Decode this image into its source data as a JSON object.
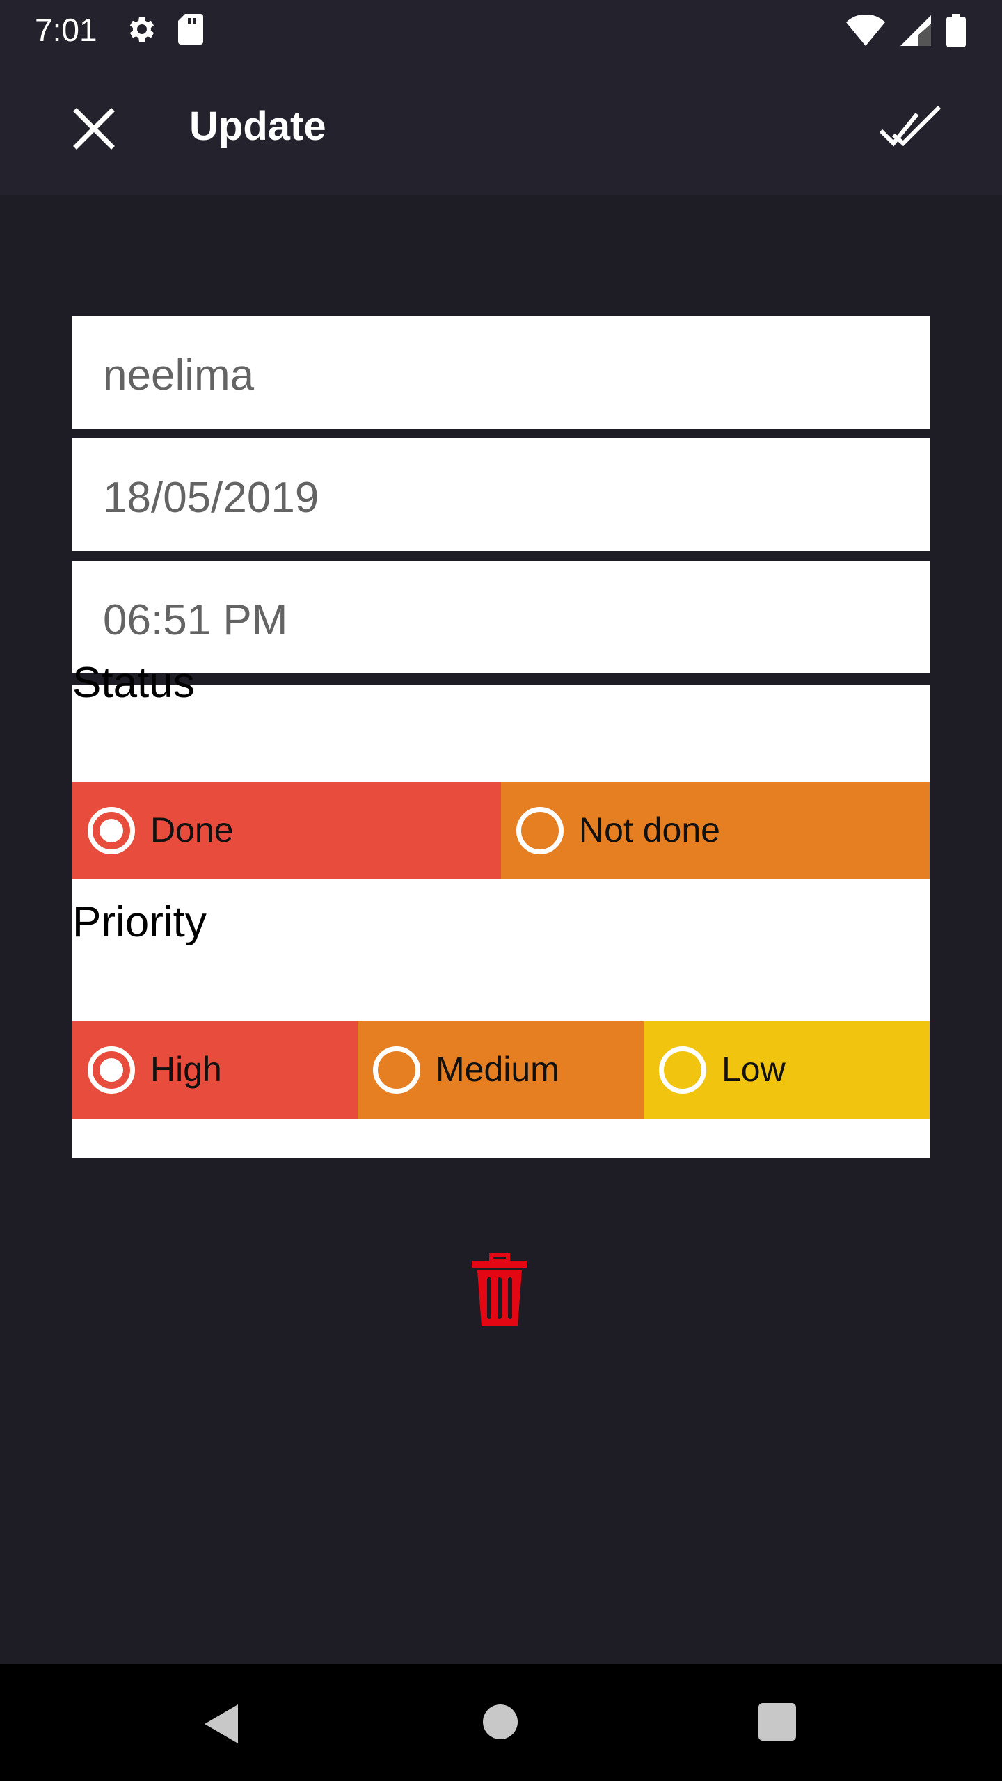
{
  "status_bar": {
    "time": "7:01",
    "icons": [
      "settings-icon",
      "sd-card-icon",
      "wifi-icon",
      "signal-icon",
      "battery-icon"
    ]
  },
  "toolbar": {
    "title": "Update",
    "close_icon": "close-icon",
    "confirm_icon": "double-check-icon"
  },
  "form": {
    "name": "neelima",
    "date": "18/05/2019",
    "time": "06:51 PM"
  },
  "status": {
    "label": "Status",
    "options": [
      {
        "label": "Done",
        "checked": true,
        "color": "#e74c3c"
      },
      {
        "label": "Not done",
        "checked": false,
        "color": "#e67e22"
      }
    ]
  },
  "priority": {
    "label": "Priority",
    "options": [
      {
        "label": "High",
        "checked": true,
        "color": "#e74c3c"
      },
      {
        "label": "Medium",
        "checked": false,
        "color": "#e67e22"
      },
      {
        "label": "Low",
        "checked": false,
        "color": "#f1c40f"
      }
    ]
  },
  "delete": {
    "icon": "trash-icon",
    "color": "#e30613"
  },
  "nav": {
    "icons": [
      "back-icon",
      "home-icon",
      "recents-icon"
    ]
  }
}
